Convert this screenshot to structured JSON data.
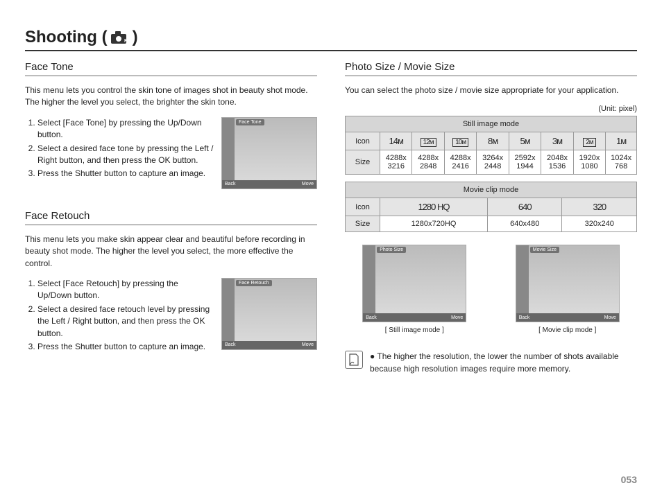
{
  "page_title_prefix": "Shooting (",
  "page_title_suffix": " )",
  "page_number": "053",
  "left": {
    "face_tone": {
      "heading": "Face Tone",
      "desc": "This menu lets you control the skin tone of images shot in beauty shot mode. The higher the level you select, the brighter the skin tone.",
      "steps": [
        "Select [Face Tone] by pressing the Up/Down button.",
        "Select a desired face tone by pressing the Left / Right button, and then press the OK button.",
        "Press the Shutter button to capture an image."
      ],
      "photo_label": "Face Tone",
      "photo_back": "Back",
      "photo_move": "Move"
    },
    "face_retouch": {
      "heading": "Face Retouch",
      "desc": "This menu lets you make skin appear clear and beautiful before recording in beauty shot mode. The higher the level you select, the more effective the control.",
      "steps": [
        "Select [Face Retouch] by pressing the Up/Down button.",
        "Select a desired face retouch level by pressing the Left / Right button, and then press the OK button.",
        "Press the Shutter button to capture an image."
      ],
      "photo_label": "Face Retouch",
      "photo_back": "Back",
      "photo_move": "Move"
    }
  },
  "right": {
    "heading": "Photo Size / Movie Size",
    "desc": "You can select the photo size / movie size appropriate for your application.",
    "unit_label": "(Unit: pixel)",
    "still_table": {
      "title": "Still image mode",
      "row_icon_label": "Icon",
      "row_size_label": "Size",
      "icons": [
        "14ᴍ",
        "12ᴍ",
        "10ᴍ",
        "8ᴍ",
        "5ᴍ",
        "3ᴍ",
        "2ᴍ",
        "1ᴍ"
      ],
      "sizes": [
        "4288x 3216",
        "4288x 2848",
        "4288x 2416",
        "3264x 2448",
        "2592x 1944",
        "2048x 1536",
        "1920x 1080",
        "1024x 768"
      ]
    },
    "movie_table": {
      "title": "Movie clip mode",
      "row_icon_label": "Icon",
      "row_size_label": "Size",
      "icons": [
        "1280 HQ",
        "640",
        "320"
      ],
      "sizes": [
        "1280x720HQ",
        "640x480",
        "320x240"
      ]
    },
    "screenshot_still": {
      "label": "Photo Size",
      "caption": "[ Still image mode ]",
      "back": "Back",
      "move": "Move"
    },
    "screenshot_movie": {
      "label": "Movie Size",
      "caption": "[ Movie clip mode ]",
      "back": "Back",
      "move": "Move"
    },
    "note": "The higher the resolution, the lower the number of shots available because high resolution images require more memory."
  }
}
